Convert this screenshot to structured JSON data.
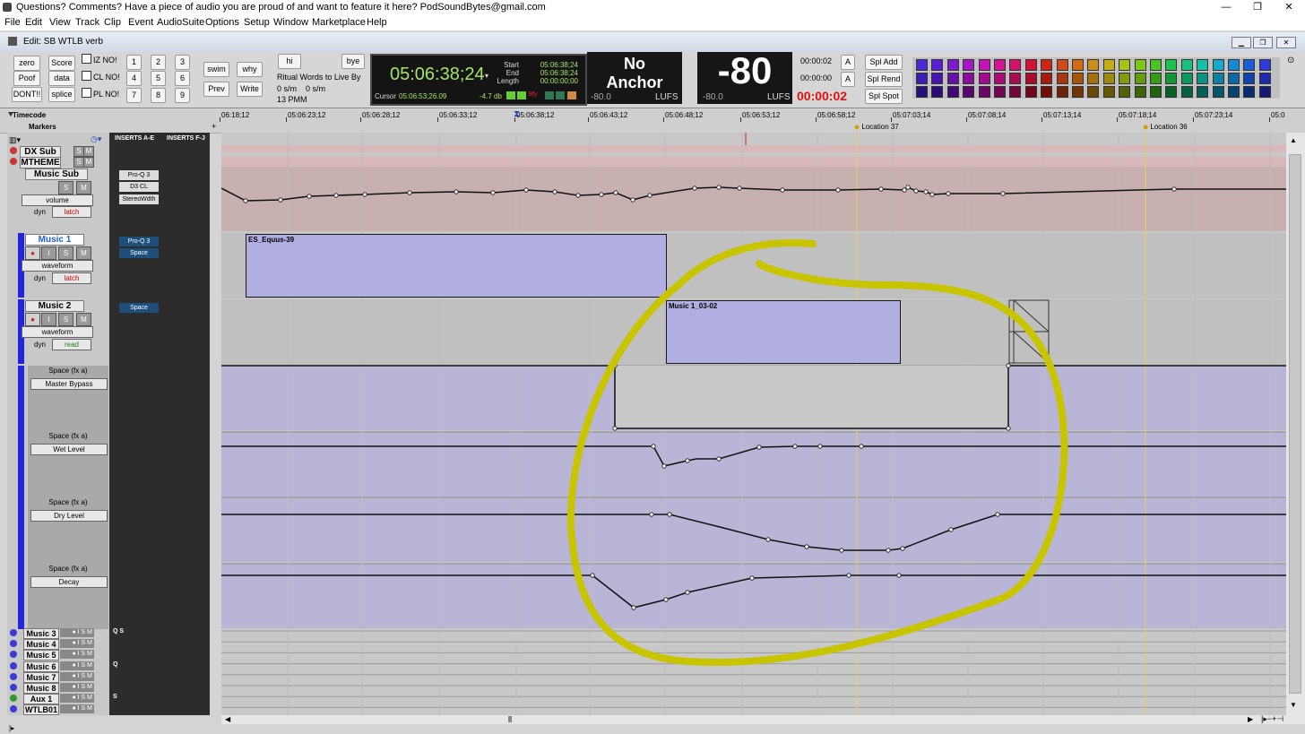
{
  "window": {
    "title": "Questions? Comments? Have a piece of audio you are proud of and want to feature it here? PodSoundBytes@gmail.com",
    "min": "—",
    "max": "❐",
    "close": "✕"
  },
  "menu": [
    "File",
    "Edit",
    "View",
    "Track",
    "Clip",
    "Event",
    "AudioSuite",
    "Options",
    "Setup",
    "Window",
    "Marketplace",
    "Help"
  ],
  "edit_window": {
    "title": "Edit: SB WTLB verb"
  },
  "toolbar": {
    "zero": "zero",
    "score": "Score",
    "poof": "Poof",
    "data": "data",
    "dont": "DONT!!",
    "splice": "splice",
    "iz": "IZ  NO!",
    "cl": "CL NO!",
    "pl": "PL NO!",
    "nums": [
      "1",
      "2",
      "3",
      "4",
      "5",
      "6",
      "7",
      "8",
      "9"
    ],
    "swim": "swim",
    "why": "why",
    "prev": "Prev",
    "write": "Write",
    "hi": "hi",
    "bye": "bye",
    "ritual": "Ritual Words to Live By",
    "rate1": "0 s/m",
    "rate2": "0 s/m",
    "pmm": "13 PMM"
  },
  "counter": {
    "main": "05:06:38;24",
    "start_label": "Start",
    "start": "05:06:38;24",
    "end_label": "End",
    "end": "05:06:38;24",
    "length_label": "Length",
    "length": "00:00:00;00",
    "cursor_label": "Cursor",
    "cursor": "05:06:53;26.09",
    "db": "-4.7 db"
  },
  "lufs1": {
    "text1": "No",
    "text2": "Anchor",
    "left": "-80.0",
    "unit": "LUFS"
  },
  "lufs2": {
    "big": "-80",
    "left": "-80.0",
    "unit": "LUFS"
  },
  "timers": {
    "t1": "00:00:02",
    "t2": "00:00:00",
    "t3": "00:00:02",
    "a1": "A",
    "a2": "A"
  },
  "spl": {
    "add": "Spl Add",
    "rend": "Spl Rend",
    "spot": "Spl Spot"
  },
  "ruler": {
    "label": "Timecode",
    "ticks": [
      "06:18;12",
      "05:06:23;12",
      "05:06:28;12",
      "05:06:33;12",
      "05:06:38;12",
      "05:06:43;12",
      "05:06:48;12",
      "05:06:53;12",
      "05:06:58;12",
      "05:07:03;14",
      "05:07:08;14",
      "05:07:13;14",
      "05:07:18;14",
      "05:07:23;14",
      "05:0"
    ]
  },
  "markers": {
    "label": "Markers",
    "loc37": "Location 37",
    "loc36": "Location 36"
  },
  "inserts_header": {
    "ae": "INSERTS A-E",
    "fj": "INSERTS F-J"
  },
  "tracks": {
    "dx_sub": "DX Sub",
    "mtheme": "MTHEME",
    "music_sub": {
      "name": "Music Sub",
      "view": "volume",
      "dyn": "dyn",
      "mode": "latch",
      "inserts": [
        "Pro-Q 3",
        "D3 CL",
        "StereoWdth"
      ]
    },
    "music1": {
      "name": "Music 1",
      "view": "waveform",
      "dyn": "dyn",
      "mode": "latch",
      "inserts": [
        "Pro-Q 3",
        "Space"
      ]
    },
    "music2": {
      "name": "Music 2",
      "view": "waveform",
      "dyn": "dyn",
      "mode": "read",
      "inserts": [
        "Space"
      ]
    },
    "lanes": [
      {
        "title": "Space  (fx a)",
        "param": "Master Bypass"
      },
      {
        "title": "Space  (fx a)",
        "param": "Wet Level"
      },
      {
        "title": "Space  (fx a)",
        "param": "Dry Level"
      },
      {
        "title": "Space  (fx a)",
        "param": "Decay"
      }
    ],
    "small": [
      "Music 3",
      "Music 4",
      "Music 5",
      "Music 6",
      "Music 7",
      "Music 8",
      "Aux 1",
      "WTLB01"
    ],
    "small_flags": [
      "Q  S",
      "",
      "",
      "Q",
      "",
      "",
      "S",
      ""
    ]
  },
  "clips": {
    "c1": "ES_Equus-39",
    "c2": "Music 1_03-02"
  },
  "buttons": {
    "S": "S",
    "M": "M",
    "I": "I",
    "record": "●"
  },
  "colors": {
    "track_bg": "#c8c8c8",
    "clip": "#b1aee2",
    "waveform": "#2424d4",
    "volume_lane": "#c8b0b0",
    "auto_lane": "#b9b5d6",
    "annotation": "#c9c400",
    "counter_green": "#a6e36b",
    "timer_red": "#e01010"
  }
}
